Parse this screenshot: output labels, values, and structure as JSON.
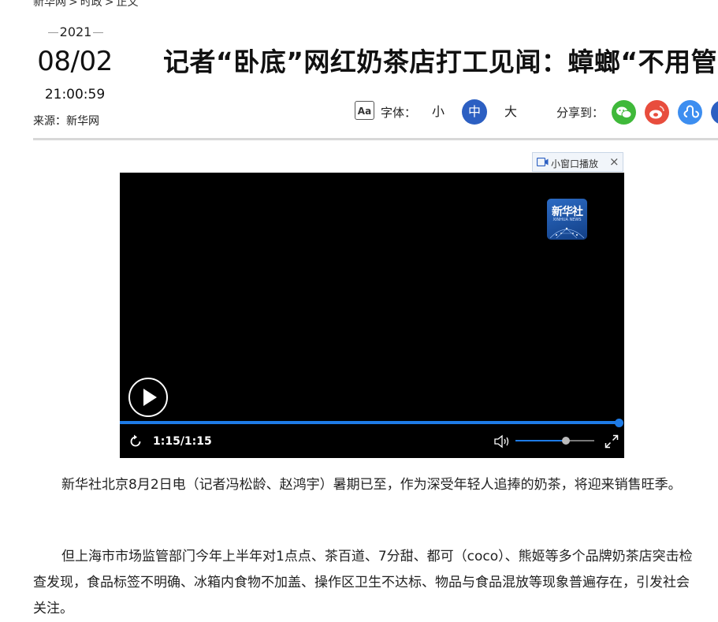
{
  "breadcrumb": [
    "新华网",
    "时政",
    "正文"
  ],
  "breadcrumb_sep": ">",
  "date": {
    "year": "2021",
    "month_day": "08/02",
    "time": "21:00:59"
  },
  "source": "来源：新华网",
  "title": "记者“卧底”网红奶茶店打工见闻：蟑螂“不用管”、",
  "font_size": {
    "icon_text": "Aa",
    "label": "字体：",
    "small": "小",
    "medium": "中",
    "large": "大",
    "selected": "medium"
  },
  "share": {
    "label": "分享到："
  },
  "icons": {
    "share": [
      "wechat-icon",
      "weibo-icon",
      "mini-program-icon",
      "more-share-icon"
    ],
    "video": [
      "play-icon",
      "replay-icon",
      "volume-icon",
      "fullscreen-icon",
      "camera-icon",
      "close-icon"
    ]
  },
  "colors": {
    "accent": "#2c5fc2",
    "progress": "#1e7be6",
    "wechat": "#3fb93a",
    "weibo": "#e84d3d",
    "miniprogram": "#3d8ef0"
  },
  "video": {
    "mini_window_label": "小窗口播放",
    "close_glyph": "×",
    "logo_text": "新华社",
    "logo_subtext": "XINHUA NEWS",
    "time_display": "1:15/1:15",
    "progress": 1.0,
    "volume": 0.64
  },
  "article": {
    "paragraphs": [
      "新华社北京8月2日电（记者冯松龄、赵鸿宇）暑期已至，作为深受年轻人追捧的奶茶，将迎来销售旺季。",
      "但上海市市场监管部门今年上半年对1点点、茶百道、7分甜、都可（coco）、熊姬等多个品牌奶茶店突击检查发现，食品标签不明确、冰箱内食物不加盖、操作区卫生不达标、物品与食品混放等现象普遍存在，引发社会关注。"
    ]
  }
}
